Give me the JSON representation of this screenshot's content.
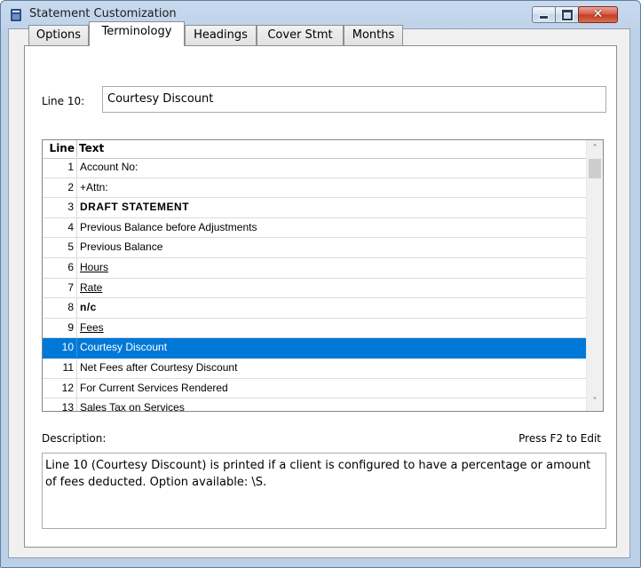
{
  "window": {
    "title": "Statement Customization"
  },
  "tabs": [
    {
      "label": "Options"
    },
    {
      "label": "Terminology"
    },
    {
      "label": "Headings"
    },
    {
      "label": "Cover Stmt"
    },
    {
      "label": "Months"
    }
  ],
  "active_tab": "Terminology",
  "editor": {
    "line_label": "Line 10:",
    "value": "Courtesy Discount"
  },
  "grid": {
    "headers": {
      "line": "Line",
      "text": "Text"
    },
    "selected_line": 10,
    "rows": [
      {
        "line": "1",
        "text": "Account No:"
      },
      {
        "line": "2",
        "text": "+Attn:"
      },
      {
        "line": "3",
        "text": "DRAFT STATEMENT"
      },
      {
        "line": "4",
        "text": "Previous Balance before Adjustments"
      },
      {
        "line": "5",
        "text": "Previous Balance"
      },
      {
        "line": "6",
        "text": "Hours"
      },
      {
        "line": "7",
        "text": "Rate"
      },
      {
        "line": "8",
        "text": "n/c"
      },
      {
        "line": "9",
        "text": "Fees"
      },
      {
        "line": "10",
        "text": "Courtesy Discount"
      },
      {
        "line": "11",
        "text": "Net Fees after Courtesy Discount"
      },
      {
        "line": "12",
        "text": "For Current Services Rendered"
      },
      {
        "line": "13",
        "text": "Sales Tax on Services"
      }
    ]
  },
  "description": {
    "label": "Description:",
    "hint": "Press F2 to Edit",
    "text": "Line 10 (Courtesy Discount) is printed if a client is configured to have a percentage or amount of fees deducted.  Option available: \\S."
  },
  "colors": {
    "selection": "#0078d7",
    "titlebar": "#c9daee",
    "close_button": "#c33a22"
  }
}
